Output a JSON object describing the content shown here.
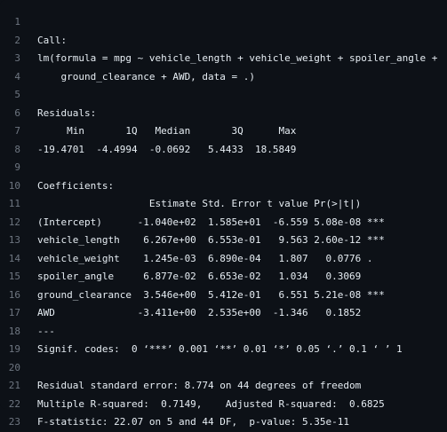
{
  "code": {
    "lines": [
      {
        "number": "1",
        "text": ""
      },
      {
        "number": "2",
        "text": "Call:"
      },
      {
        "number": "3",
        "text": "lm(formula = mpg ~ vehicle_length + vehicle_weight + spoiler_angle +"
      },
      {
        "number": "4",
        "text": "    ground_clearance + AWD, data = .)"
      },
      {
        "number": "5",
        "text": ""
      },
      {
        "number": "6",
        "text": "Residuals:"
      },
      {
        "number": "7",
        "text": "     Min       1Q   Median       3Q      Max "
      },
      {
        "number": "8",
        "text": "-19.4701  -4.4994  -0.0692   5.4433  18.5849 "
      },
      {
        "number": "9",
        "text": ""
      },
      {
        "number": "10",
        "text": "Coefficients:"
      },
      {
        "number": "11",
        "text": "                   Estimate Std. Error t value Pr(>|t|)    "
      },
      {
        "number": "12",
        "text": "(Intercept)      -1.040e+02  1.585e+01  -6.559 5.08e-08 ***"
      },
      {
        "number": "13",
        "text": "vehicle_length    6.267e+00  6.553e-01   9.563 2.60e-12 ***"
      },
      {
        "number": "14",
        "text": "vehicle_weight    1.245e-03  6.890e-04   1.807   0.0776 .  "
      },
      {
        "number": "15",
        "text": "spoiler_angle     6.877e-02  6.653e-02   1.034   0.3069    "
      },
      {
        "number": "16",
        "text": "ground_clearance  3.546e+00  5.412e-01   6.551 5.21e-08 ***"
      },
      {
        "number": "17",
        "text": "AWD              -3.411e+00  2.535e+00  -1.346   0.1852    "
      },
      {
        "number": "18",
        "text": "---"
      },
      {
        "number": "19",
        "text": "Signif. codes:  0 ‘***’ 0.001 ‘**’ 0.01 ‘*’ 0.05 ‘.’ 0.1 ‘ ’ 1"
      },
      {
        "number": "20",
        "text": ""
      },
      {
        "number": "21",
        "text": "Residual standard error: 8.774 on 44 degrees of freedom"
      },
      {
        "number": "22",
        "text": "Multiple R-squared:  0.7149,\tAdjusted R-squared:  0.6825 "
      },
      {
        "number": "23",
        "text": "F-statistic: 22.07 on 5 and 44 DF,  p-value: 5.35e-11"
      }
    ]
  }
}
